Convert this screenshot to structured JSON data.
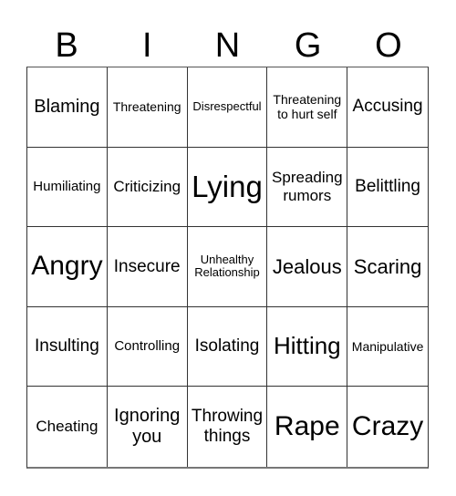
{
  "header": {
    "letters": [
      "B",
      "I",
      "N",
      "G",
      "O"
    ]
  },
  "board": {
    "cells": [
      [
        "Blaming",
        "Threatening",
        "Disrespectful",
        "Threatening to hurt self",
        "Accusing"
      ],
      [
        "Humiliating",
        "Criticizing",
        "Lying",
        "Spreading rumors",
        "Belittling"
      ],
      [
        "Angry",
        "Insecure",
        "Unhealthy Relationship",
        "Jealous",
        "Scaring"
      ],
      [
        "Insulting",
        "Controlling",
        "Isolating",
        "Hitting",
        "Manipulative"
      ],
      [
        "Cheating",
        "Ignoring you",
        "Throwing things",
        "Rape",
        "Crazy"
      ]
    ]
  }
}
